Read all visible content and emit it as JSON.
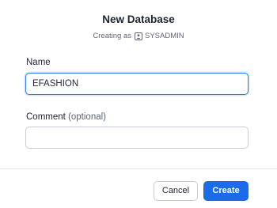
{
  "dialog": {
    "title": "New Database",
    "subtitle_prefix": "Creating as",
    "role": "SYSADMIN",
    "role_icon": "user-badge-icon"
  },
  "form": {
    "name_label": "Name",
    "name_value": "EFASHION",
    "comment_label": "Comment",
    "comment_optional": "(optional)",
    "comment_value": ""
  },
  "footer": {
    "cancel_label": "Cancel",
    "create_label": "Create"
  },
  "colors": {
    "primary": "#1a6ce8",
    "focus_border": "#2f7be8",
    "text": "#1f2430",
    "muted": "#5f6673",
    "border": "#c9ced6"
  }
}
